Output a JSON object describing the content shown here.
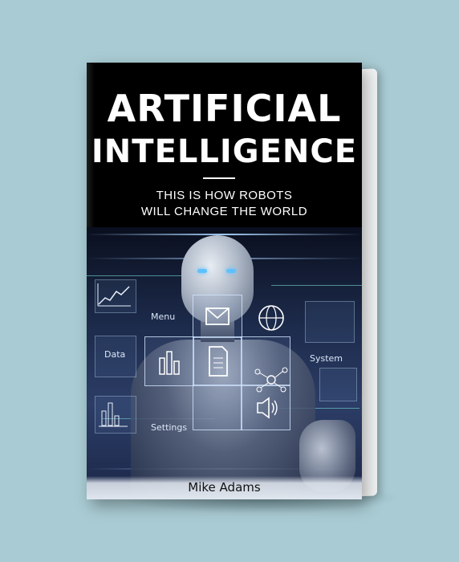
{
  "book": {
    "title_line1": "ARTIFICIAL",
    "title_line2": "INTELLIGENCE",
    "subtitle_line1": "THIS IS HOW ROBOTS",
    "subtitle_line2": "WILL CHANGE THE WORLD",
    "author": "Mike Adams"
  },
  "ui_labels": {
    "menu": "Menu",
    "data": "Data",
    "settings": "Settings",
    "system": "System"
  },
  "icons": {
    "mail": "mail-icon",
    "globe": "globe-icon",
    "document": "document-icon",
    "chart": "bar-chart-icon",
    "line_chart": "line-chart-icon",
    "network": "network-icon",
    "speaker": "speaker-icon"
  },
  "colors": {
    "background": "#a9cbd3",
    "cover_top": "#000000",
    "title_text": "#ffffff",
    "author_text": "#111111"
  }
}
